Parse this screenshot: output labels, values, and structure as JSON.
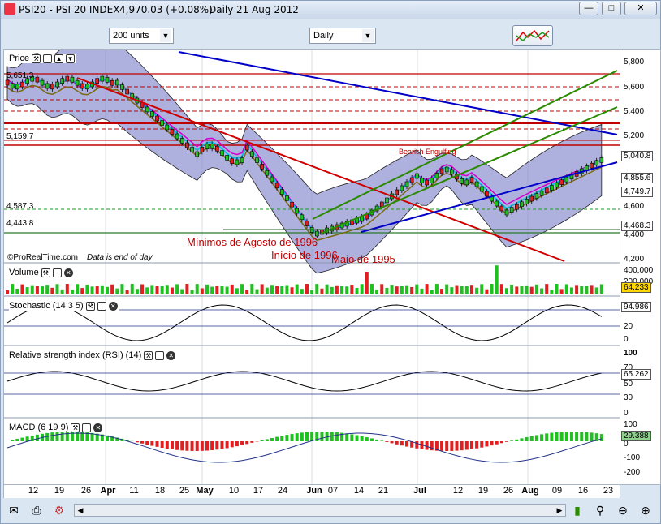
{
  "window": {
    "title": "PSI20 - PSI 20 INDEX",
    "last": "4,970.03 (+0.08%)",
    "period": "Daily",
    "date": "21 Aug 2012"
  },
  "toolbar": {
    "units": "200 units",
    "timeframe": "Daily"
  },
  "panels": {
    "price": "Price",
    "volume": "Volume",
    "stochastic": "Stochastic (14 3 5)",
    "rsi": "Relative strength index (RSI) (14)",
    "macd": "MACD (6 19 9)"
  },
  "price_panel": {
    "left_labels": [
      "5,651.3",
      "5,159.7",
      "4,587.3",
      "4,443.8"
    ],
    "axis_ticks": [
      "5,800",
      "5,600",
      "5,400",
      "5,200",
      "4,600",
      "4,400",
      "4,200"
    ],
    "boxed_values": [
      "5,040.8",
      "4,855.6",
      "4,749.7",
      "4,468.3"
    ],
    "footer": "©ProRealTime.com",
    "footer_note": "Data is end of day",
    "pattern_label": "Bearish Engulfing",
    "annotations": [
      "Mínimos de Agosto de 1996",
      "Início de 1996",
      "Maio de 1995"
    ]
  },
  "volume_panel": {
    "ticks": [
      "400,000",
      "200,000"
    ],
    "value": "64,233"
  },
  "stochastic_panel": {
    "ticks": [
      "80",
      "20",
      "0"
    ],
    "value": "94.986"
  },
  "rsi_panel": {
    "ticks": [
      "100",
      "70",
      "50",
      "30",
      "0"
    ],
    "value": "65.262"
  },
  "macd_panel": {
    "ticks": [
      "100",
      "0",
      "-100",
      "-200"
    ],
    "value": "29.388"
  },
  "xaxis": {
    "labels": [
      {
        "t": "12",
        "b": false
      },
      {
        "t": "19",
        "b": false
      },
      {
        "t": "26",
        "b": false
      },
      {
        "t": "Apr",
        "b": true
      },
      {
        "t": "11",
        "b": false
      },
      {
        "t": "18",
        "b": false
      },
      {
        "t": "25",
        "b": false
      },
      {
        "t": "May",
        "b": true
      },
      {
        "t": "10",
        "b": false
      },
      {
        "t": "17",
        "b": false
      },
      {
        "t": "24",
        "b": false
      },
      {
        "t": "Jun",
        "b": true
      },
      {
        "t": "07",
        "b": false
      },
      {
        "t": "14",
        "b": false
      },
      {
        "t": "21",
        "b": false
      },
      {
        "t": "Jul",
        "b": true
      },
      {
        "t": "12",
        "b": false
      },
      {
        "t": "19",
        "b": false
      },
      {
        "t": "26",
        "b": false
      },
      {
        "t": "Aug",
        "b": true
      },
      {
        "t": "09",
        "b": false
      },
      {
        "t": "16",
        "b": false
      },
      {
        "t": "23",
        "b": false
      }
    ]
  },
  "colors": {
    "up": "#20c020",
    "down": "#e02020",
    "band": "#8b8fcf",
    "trend_red": "#d00000",
    "trend_blue": "#0000c8",
    "trend_green": "#2a8a00"
  }
}
